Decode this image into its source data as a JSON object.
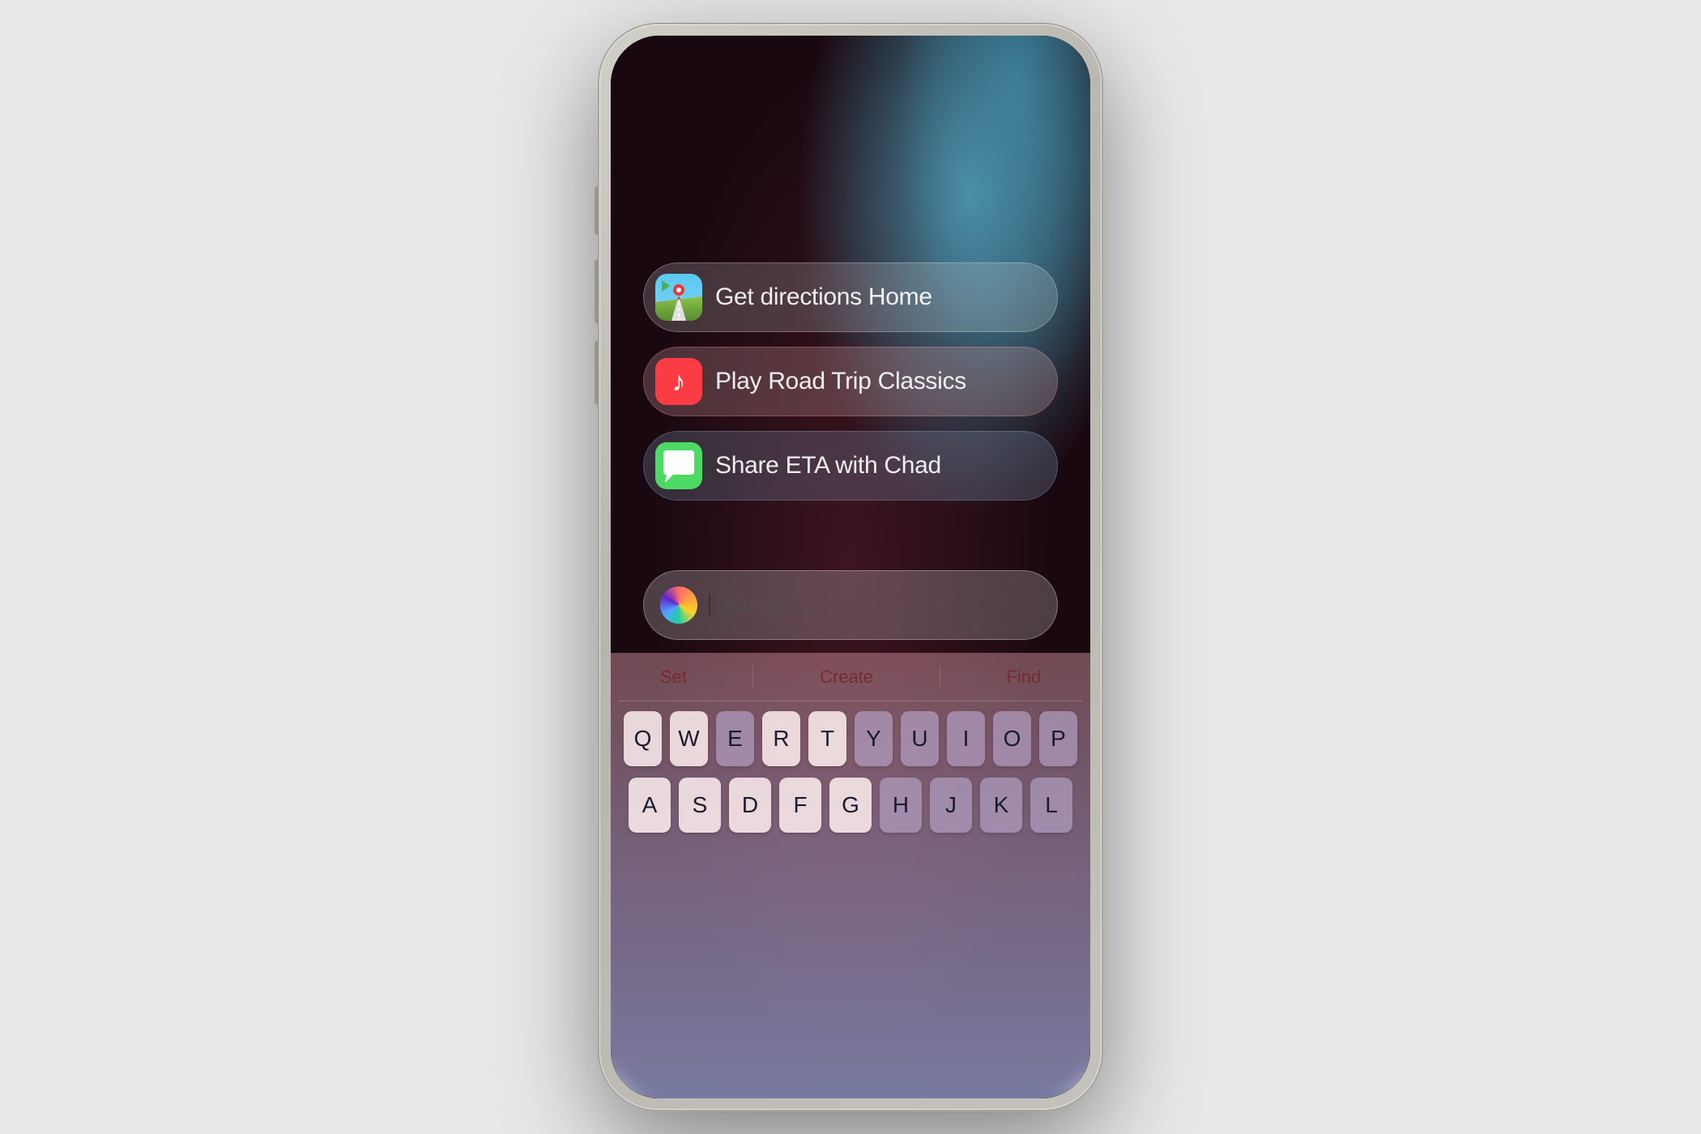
{
  "phone": {
    "suggestions": [
      {
        "id": "directions",
        "label": "Get directions Home",
        "icon_type": "maps",
        "card_class": "card-directions"
      },
      {
        "id": "music",
        "label": "Play Road Trip Classics",
        "icon_type": "music",
        "card_class": "card-music"
      },
      {
        "id": "messages",
        "label": "Share ETA with Chad",
        "icon_type": "messages",
        "card_class": "card-messages"
      }
    ],
    "siri_bar": {
      "placeholder": "Ask Siri..."
    },
    "keyboard": {
      "shortcuts": [
        "Set",
        "Create",
        "Find"
      ],
      "rows": [
        [
          "Q",
          "W",
          "E",
          "R",
          "T",
          "Y",
          "U",
          "I",
          "O",
          "P"
        ],
        [
          "A",
          "S",
          "D",
          "F",
          "G",
          "H",
          "J",
          "K",
          "L"
        ]
      ]
    }
  }
}
